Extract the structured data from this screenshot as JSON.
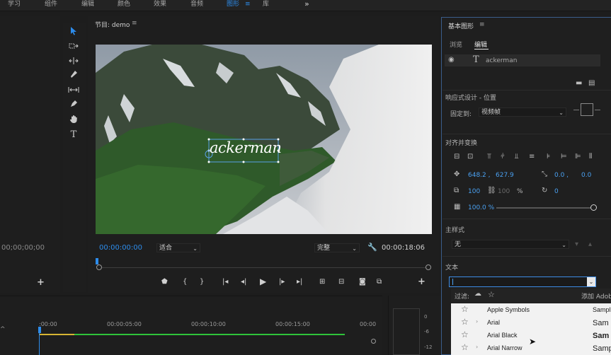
{
  "menu": {
    "items": [
      "学习",
      "组件",
      "编辑",
      "颜色",
      "效果",
      "音频",
      "图形",
      "库"
    ],
    "active": "图形",
    "more": "»"
  },
  "project": {
    "timecode": "00;00;00;00",
    "add": "+"
  },
  "tools": {
    "items": [
      "selection-tool",
      "track-select-tool",
      "ripple-edit-tool",
      "razor-tool",
      "slip-tool",
      "pen-tool",
      "hand-tool",
      "type-tool"
    ]
  },
  "monitor": {
    "title": "节目: demo",
    "menu": "≡",
    "video_text": "ackerman",
    "current_time": "00:00:00:00",
    "zoom": "适合",
    "quality": "完整",
    "duration": "00:00:18:06",
    "add": "+"
  },
  "graphics": {
    "title": "基本图形",
    "menu": "≡",
    "tab_browse": "浏览",
    "tab_edit": "编辑",
    "layer_name": "ackerman",
    "responsive_title": "响应式设计 - 位置",
    "pin_label": "固定到:",
    "pin_value": "视频帧",
    "align_title": "对齐并变换",
    "pos_x": "648.2 ,",
    "pos_y": "627.9",
    "anchor_x": "0.0 ,",
    "anchor_y": "0.0",
    "scale": "100",
    "scale2": "100",
    "scale_unit": "%",
    "rotation": "0",
    "opacity": "100.0 %",
    "opacity_value": 100,
    "master_style_title": "主样式",
    "master_style_value": "无",
    "text_title": "文本",
    "font_input": ""
  },
  "fonts": {
    "filter_label": "过滤:",
    "add_adobe": "添加 Adob",
    "items": [
      {
        "name": "Apple Symbols",
        "sample": "Sampl",
        "has_children": false
      },
      {
        "name": "Arial",
        "sample": "Sam",
        "has_children": true
      },
      {
        "name": "Arial Black",
        "sample": "Sam",
        "has_children": false
      },
      {
        "name": "Arial Narrow",
        "sample": "Samp",
        "has_children": true
      }
    ]
  },
  "timeline": {
    "ticks": [
      ":00:00",
      "00:00:05:00",
      "00:00:10:00",
      "00:00:15:00",
      "00:00"
    ]
  },
  "meter": {
    "labels": [
      "0",
      "-6",
      "-12"
    ]
  },
  "colors": {
    "accent": "#2d8ceb",
    "panel": "#1e1e1e",
    "range": "#2fc33a"
  }
}
